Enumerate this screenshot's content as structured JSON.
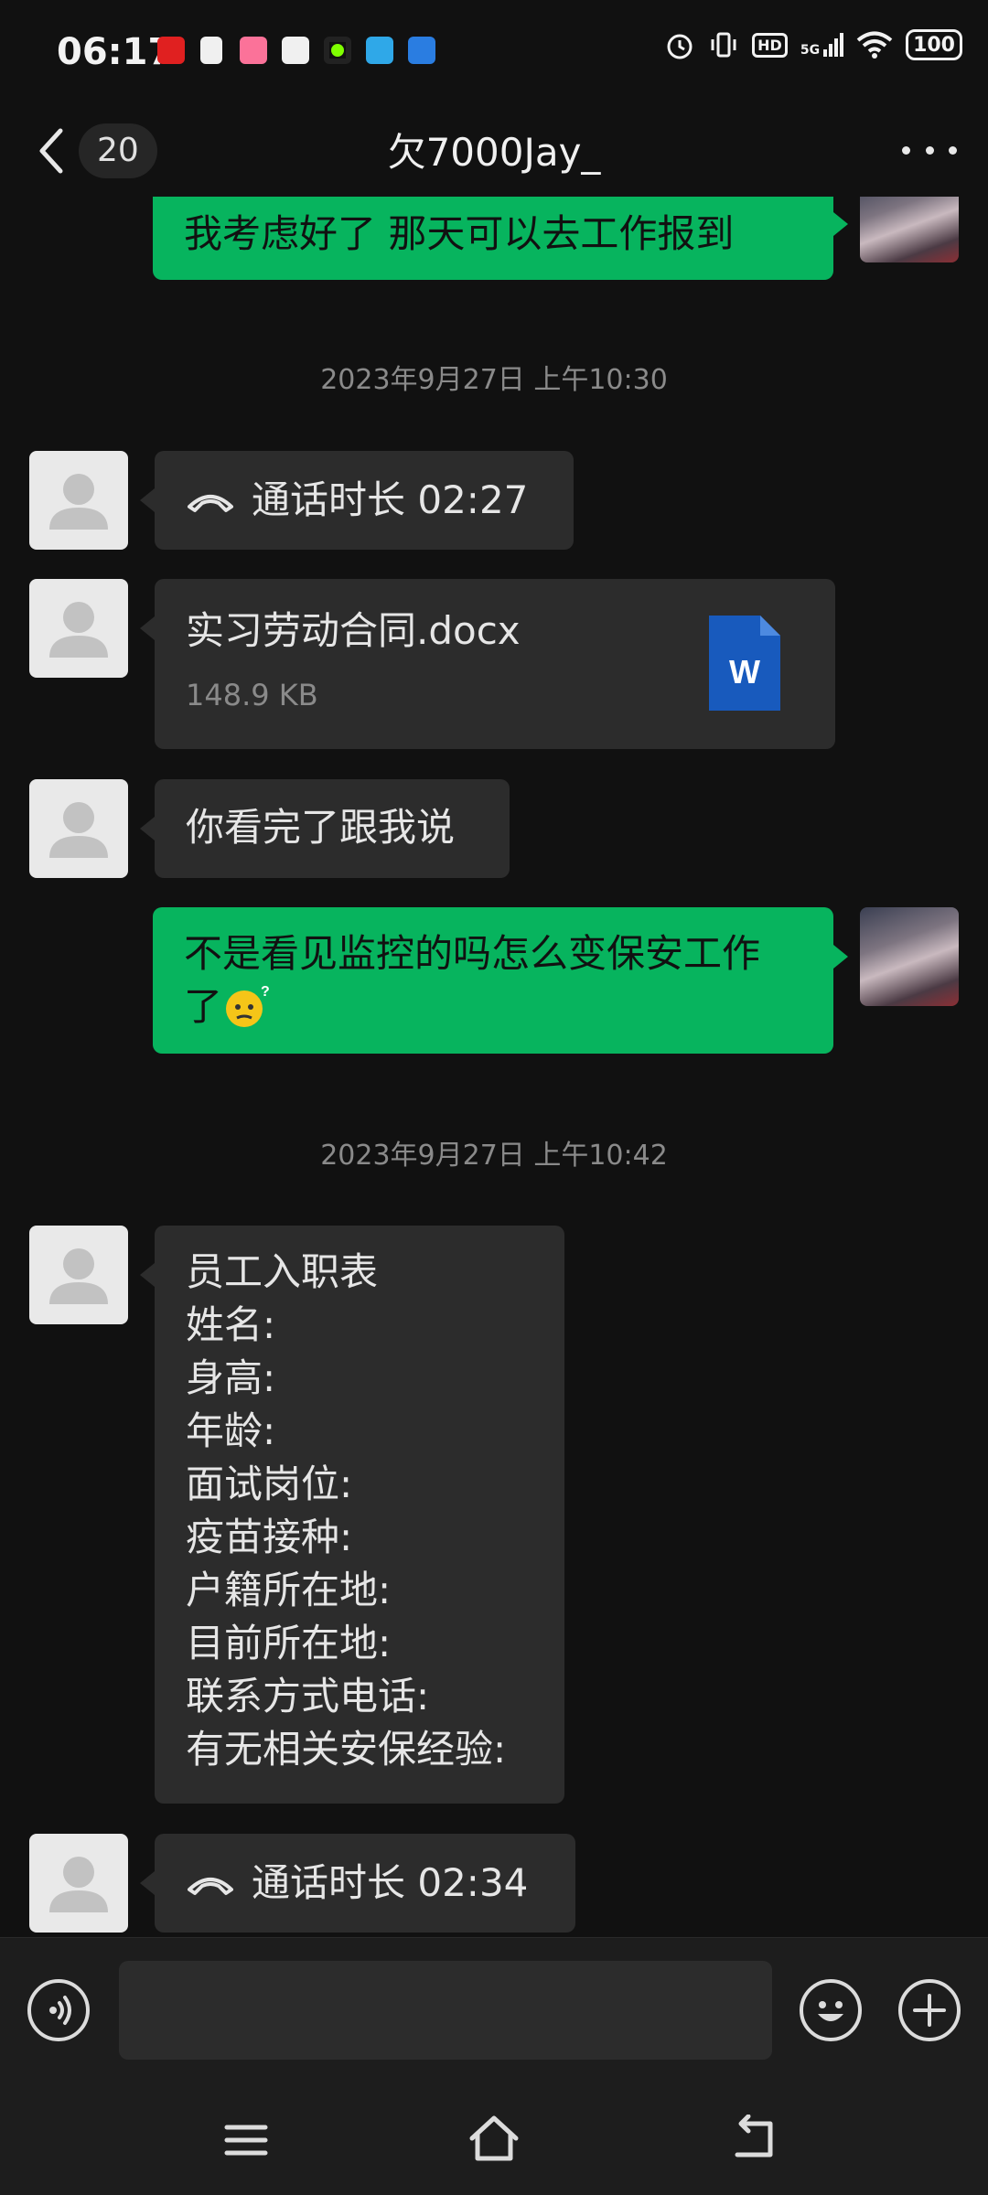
{
  "status_bar": {
    "time": "06:17",
    "app_icons": [
      "ximalaya-icon",
      "notes-icon",
      "bilibili-icon",
      "video-icon",
      "green-dot-app-icon",
      "cloud-icon",
      "blue-app-icon"
    ],
    "battery": "100",
    "network": "5G",
    "hd": "HD"
  },
  "header": {
    "unread_count": "20",
    "title": "欠7000Jay_"
  },
  "messages": {
    "m1": {
      "text": "我考虑好了 那天可以去工作报到"
    },
    "t1": "2023年9月27日 上午10:30",
    "m2": {
      "label": "通话时长 02:27"
    },
    "m3": {
      "file_name": "实习劳动合同.docx",
      "file_size": "148.9 KB",
      "file_icon_letter": "W"
    },
    "m4": {
      "text": "你看完了跟我说"
    },
    "m5": {
      "line1": "不是看见监控的吗怎么变保安工作",
      "line2": "了",
      "emoji": "confused-face-emoji"
    },
    "t2": "2023年9月27日 上午10:42",
    "m6": {
      "lines": [
        "员工入职表",
        "姓名:",
        "身高:",
        "年龄:",
        "面试岗位:",
        "疫苗接种:",
        "户籍所在地:",
        "目前所在地:",
        "联系方式电话:",
        "有无相关安保经验:"
      ]
    },
    "m7": {
      "label": "通话时长 02:34"
    }
  },
  "input_bar": {
    "value": "",
    "icons": [
      "voice-icon",
      "emoji-icon",
      "plus-icon"
    ]
  },
  "nav_bar": {
    "icons": [
      "menu-icon",
      "home-icon",
      "back-nav-icon"
    ]
  },
  "colors": {
    "background": "#111111",
    "incoming_bubble": "#2c2c2c",
    "outgoing_bubble": "#07b45e",
    "word_blue": "#185abd",
    "caret": "#07c160"
  }
}
